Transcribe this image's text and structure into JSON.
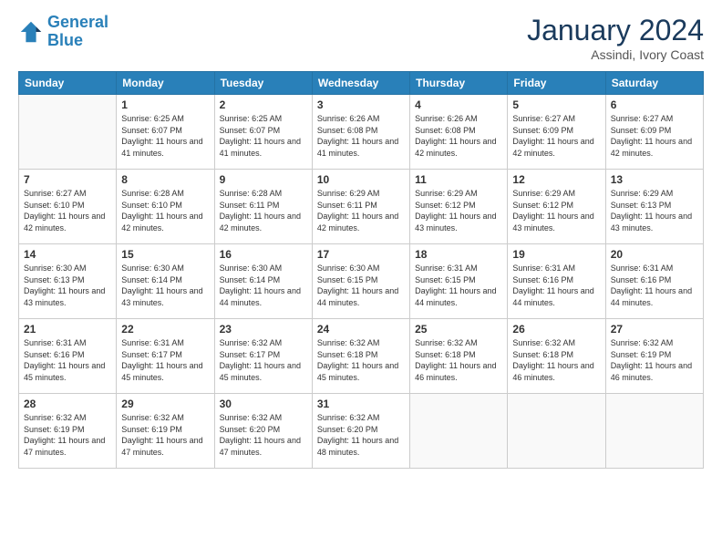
{
  "header": {
    "logo_line1": "General",
    "logo_line2": "Blue",
    "month_title": "January 2024",
    "subtitle": "Assindi, Ivory Coast"
  },
  "weekdays": [
    "Sunday",
    "Monday",
    "Tuesday",
    "Wednesday",
    "Thursday",
    "Friday",
    "Saturday"
  ],
  "weeks": [
    [
      {
        "day": "",
        "sunrise": "",
        "sunset": "",
        "daylight": ""
      },
      {
        "day": "1",
        "sunrise": "Sunrise: 6:25 AM",
        "sunset": "Sunset: 6:07 PM",
        "daylight": "Daylight: 11 hours and 41 minutes."
      },
      {
        "day": "2",
        "sunrise": "Sunrise: 6:25 AM",
        "sunset": "Sunset: 6:07 PM",
        "daylight": "Daylight: 11 hours and 41 minutes."
      },
      {
        "day": "3",
        "sunrise": "Sunrise: 6:26 AM",
        "sunset": "Sunset: 6:08 PM",
        "daylight": "Daylight: 11 hours and 41 minutes."
      },
      {
        "day": "4",
        "sunrise": "Sunrise: 6:26 AM",
        "sunset": "Sunset: 6:08 PM",
        "daylight": "Daylight: 11 hours and 42 minutes."
      },
      {
        "day": "5",
        "sunrise": "Sunrise: 6:27 AM",
        "sunset": "Sunset: 6:09 PM",
        "daylight": "Daylight: 11 hours and 42 minutes."
      },
      {
        "day": "6",
        "sunrise": "Sunrise: 6:27 AM",
        "sunset": "Sunset: 6:09 PM",
        "daylight": "Daylight: 11 hours and 42 minutes."
      }
    ],
    [
      {
        "day": "7",
        "sunrise": "Sunrise: 6:27 AM",
        "sunset": "Sunset: 6:10 PM",
        "daylight": "Daylight: 11 hours and 42 minutes."
      },
      {
        "day": "8",
        "sunrise": "Sunrise: 6:28 AM",
        "sunset": "Sunset: 6:10 PM",
        "daylight": "Daylight: 11 hours and 42 minutes."
      },
      {
        "day": "9",
        "sunrise": "Sunrise: 6:28 AM",
        "sunset": "Sunset: 6:11 PM",
        "daylight": "Daylight: 11 hours and 42 minutes."
      },
      {
        "day": "10",
        "sunrise": "Sunrise: 6:29 AM",
        "sunset": "Sunset: 6:11 PM",
        "daylight": "Daylight: 11 hours and 42 minutes."
      },
      {
        "day": "11",
        "sunrise": "Sunrise: 6:29 AM",
        "sunset": "Sunset: 6:12 PM",
        "daylight": "Daylight: 11 hours and 43 minutes."
      },
      {
        "day": "12",
        "sunrise": "Sunrise: 6:29 AM",
        "sunset": "Sunset: 6:12 PM",
        "daylight": "Daylight: 11 hours and 43 minutes."
      },
      {
        "day": "13",
        "sunrise": "Sunrise: 6:29 AM",
        "sunset": "Sunset: 6:13 PM",
        "daylight": "Daylight: 11 hours and 43 minutes."
      }
    ],
    [
      {
        "day": "14",
        "sunrise": "Sunrise: 6:30 AM",
        "sunset": "Sunset: 6:13 PM",
        "daylight": "Daylight: 11 hours and 43 minutes."
      },
      {
        "day": "15",
        "sunrise": "Sunrise: 6:30 AM",
        "sunset": "Sunset: 6:14 PM",
        "daylight": "Daylight: 11 hours and 43 minutes."
      },
      {
        "day": "16",
        "sunrise": "Sunrise: 6:30 AM",
        "sunset": "Sunset: 6:14 PM",
        "daylight": "Daylight: 11 hours and 44 minutes."
      },
      {
        "day": "17",
        "sunrise": "Sunrise: 6:30 AM",
        "sunset": "Sunset: 6:15 PM",
        "daylight": "Daylight: 11 hours and 44 minutes."
      },
      {
        "day": "18",
        "sunrise": "Sunrise: 6:31 AM",
        "sunset": "Sunset: 6:15 PM",
        "daylight": "Daylight: 11 hours and 44 minutes."
      },
      {
        "day": "19",
        "sunrise": "Sunrise: 6:31 AM",
        "sunset": "Sunset: 6:16 PM",
        "daylight": "Daylight: 11 hours and 44 minutes."
      },
      {
        "day": "20",
        "sunrise": "Sunrise: 6:31 AM",
        "sunset": "Sunset: 6:16 PM",
        "daylight": "Daylight: 11 hours and 44 minutes."
      }
    ],
    [
      {
        "day": "21",
        "sunrise": "Sunrise: 6:31 AM",
        "sunset": "Sunset: 6:16 PM",
        "daylight": "Daylight: 11 hours and 45 minutes."
      },
      {
        "day": "22",
        "sunrise": "Sunrise: 6:31 AM",
        "sunset": "Sunset: 6:17 PM",
        "daylight": "Daylight: 11 hours and 45 minutes."
      },
      {
        "day": "23",
        "sunrise": "Sunrise: 6:32 AM",
        "sunset": "Sunset: 6:17 PM",
        "daylight": "Daylight: 11 hours and 45 minutes."
      },
      {
        "day": "24",
        "sunrise": "Sunrise: 6:32 AM",
        "sunset": "Sunset: 6:18 PM",
        "daylight": "Daylight: 11 hours and 45 minutes."
      },
      {
        "day": "25",
        "sunrise": "Sunrise: 6:32 AM",
        "sunset": "Sunset: 6:18 PM",
        "daylight": "Daylight: 11 hours and 46 minutes."
      },
      {
        "day": "26",
        "sunrise": "Sunrise: 6:32 AM",
        "sunset": "Sunset: 6:18 PM",
        "daylight": "Daylight: 11 hours and 46 minutes."
      },
      {
        "day": "27",
        "sunrise": "Sunrise: 6:32 AM",
        "sunset": "Sunset: 6:19 PM",
        "daylight": "Daylight: 11 hours and 46 minutes."
      }
    ],
    [
      {
        "day": "28",
        "sunrise": "Sunrise: 6:32 AM",
        "sunset": "Sunset: 6:19 PM",
        "daylight": "Daylight: 11 hours and 47 minutes."
      },
      {
        "day": "29",
        "sunrise": "Sunrise: 6:32 AM",
        "sunset": "Sunset: 6:19 PM",
        "daylight": "Daylight: 11 hours and 47 minutes."
      },
      {
        "day": "30",
        "sunrise": "Sunrise: 6:32 AM",
        "sunset": "Sunset: 6:20 PM",
        "daylight": "Daylight: 11 hours and 47 minutes."
      },
      {
        "day": "31",
        "sunrise": "Sunrise: 6:32 AM",
        "sunset": "Sunset: 6:20 PM",
        "daylight": "Daylight: 11 hours and 48 minutes."
      },
      {
        "day": "",
        "sunrise": "",
        "sunset": "",
        "daylight": ""
      },
      {
        "day": "",
        "sunrise": "",
        "sunset": "",
        "daylight": ""
      },
      {
        "day": "",
        "sunrise": "",
        "sunset": "",
        "daylight": ""
      }
    ]
  ]
}
